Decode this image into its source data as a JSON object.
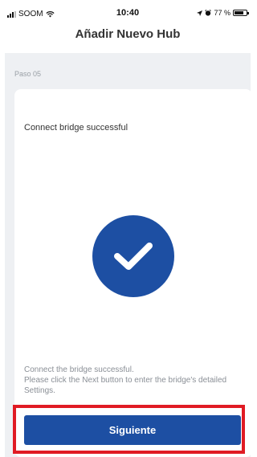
{
  "status_bar": {
    "carrier": "SOOM",
    "time": "10:40",
    "battery_text": "77 %",
    "battery_level": 0.77
  },
  "header": {
    "title": "Añadir Nuevo Hub"
  },
  "step": {
    "label": "Paso 05"
  },
  "card": {
    "title": "Connect bridge successful",
    "icon": "checkmark-circle-icon",
    "description": "Connect the bridge successful.\n Please click the Next button to enter the bridge's detailed Settings."
  },
  "footer": {
    "next_label": "Siguiente"
  },
  "colors": {
    "accent": "#1d4fa3",
    "highlight": "#e01b24",
    "background": "#eef0f3"
  }
}
